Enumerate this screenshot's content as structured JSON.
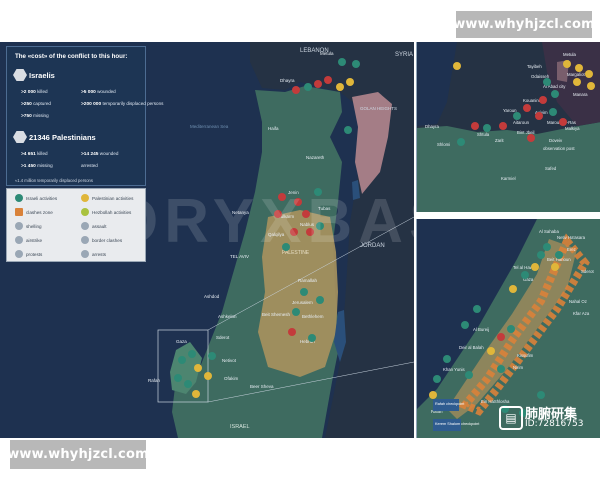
{
  "watermarks": {
    "top": "www.whyhjzcl.com",
    "bottom": "www.whyhjzcl.com",
    "overlay": "ORYXBASE"
  },
  "logo": {
    "icon": "author-badge-icon",
    "name": "肺腑研集",
    "id": "ID:72816753"
  },
  "legend": {
    "title": "The «cost» of the conflict to this hour:",
    "israelis": {
      "label": "Israelis",
      "stats": [
        {
          "value": ">2 000",
          "label": "killed"
        },
        {
          "value": ">5 000",
          "label": "wounded"
        },
        {
          "value": ">250",
          "label": "captured"
        },
        {
          "value": ">200 000",
          "label": "temporarily displaced persons"
        },
        {
          "value": ">750",
          "label": "missing"
        }
      ]
    },
    "palestinians": {
      "label": "21346 Palestinians",
      "stats": [
        {
          "value": ">4 651",
          "label": "killed"
        },
        {
          "value": ">14 245",
          "label": "wounded"
        },
        {
          "value": ">1 450",
          "label": "missing"
        },
        {
          "value": "",
          "label": "arrested"
        }
      ]
    },
    "displaced": "≈1.4 million temporarily displaced persons"
  },
  "key": {
    "items": [
      {
        "label": "Israeli activities",
        "color": "#2d8a76"
      },
      {
        "label": "Palestinian activities",
        "color": "#e0b63a"
      },
      {
        "label": "clashes zone",
        "color": "#d9823a"
      },
      {
        "label": "Hezbollah activities",
        "color": "#a9c23f"
      },
      {
        "label": "shelling",
        "color": "#9aa7b5"
      },
      {
        "label": "assault",
        "color": "#9aa7b5"
      },
      {
        "label": "airstrike",
        "color": "#9aa7b5"
      },
      {
        "label": "border clashes",
        "color": "#9aa7b5"
      },
      {
        "label": "protests",
        "color": "#9aa7b5"
      },
      {
        "label": "arrests",
        "color": "#9aa7b5"
      }
    ]
  },
  "map_labels": {
    "countries": [
      "LEBANON",
      "SYRIA",
      "GOLAN HEIGHTS",
      "JORDAN",
      "PALESTINE",
      "ISRAEL"
    ],
    "sea": "Mediterranean Sea",
    "cities_main": [
      "Metula",
      "Dhayra",
      "Haifa",
      "Nazareth",
      "Jenin",
      "Tulkarm",
      "Nablus",
      "Qalqilya",
      "Netanya",
      "Tubas",
      "TEL AVIV",
      "Ramallah",
      "Beit Shemesh",
      "Jerusalem",
      "Bethlehem",
      "Ashdod",
      "Ashkelon",
      "Hebron",
      "Gaza",
      "Sderot",
      "Netivot",
      "Rafah",
      "Ofakim",
      "Beer Sheva"
    ],
    "cities_north": [
      "Metula",
      "Tayibeh",
      "Odaisseh",
      "Margaliot",
      "Al Abad city",
      "Manara",
      "Yaroun",
      "Kouanine",
      "Avivim",
      "Maroun Ar-Ras",
      "Malkiya",
      "Dhayra",
      "Aitaroun",
      "Bint Jbeil",
      "Shtula",
      "Zarit",
      "Doveiv",
      "observation post",
      "Shlomi",
      "Safed",
      "Karmiel"
    ],
    "cities_gaza": [
      "Al Sahaba",
      "Netiv Ha'asara",
      "Erez",
      "Tel al Hawa",
      "Sderot",
      "Beit Hanoun",
      "Gaza",
      "Nahal Oz",
      "Kfar Aza",
      "Al Bureij",
      "Nirim",
      "Kissufim",
      "Rafah",
      "Deir al Balah",
      "Khan Yunis",
      "Ein HaShlosha"
    ],
    "crossings": [
      "Rafah checkpoint",
      "Kerem Shalom checkpoint"
    ]
  }
}
